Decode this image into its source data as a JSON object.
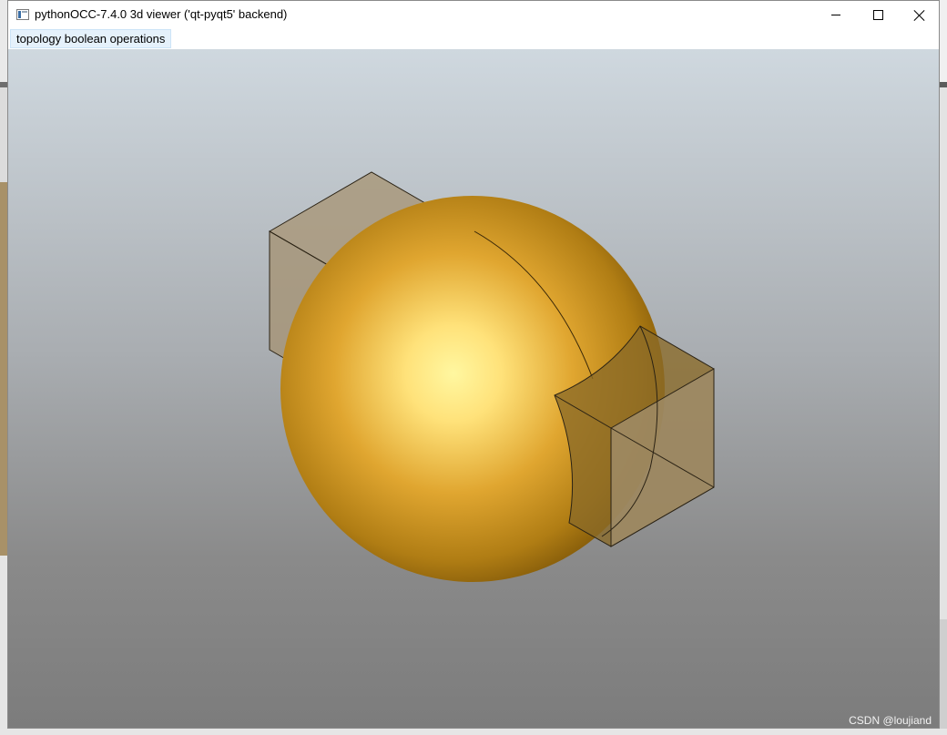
{
  "window": {
    "title": "pythonOCC-7.4.0 3d viewer ('qt-pyqt5' backend)",
    "controls": [
      "minimize",
      "maximize",
      "close"
    ]
  },
  "menubar": {
    "items": [
      {
        "label": "topology boolean operations"
      }
    ]
  },
  "viewport": {
    "background_top": "#cfd8df",
    "background_bottom": "#7c7c7c",
    "objects": [
      {
        "name": "sphere",
        "color": "#b07d14",
        "highlight": "#fff7a0"
      },
      {
        "name": "box-upper-left",
        "color": "#a8997d",
        "transparent": true
      },
      {
        "name": "box-lower-right",
        "color": "#a8997d",
        "transparent": true
      }
    ]
  },
  "watermark": "CSDN @loujiand"
}
